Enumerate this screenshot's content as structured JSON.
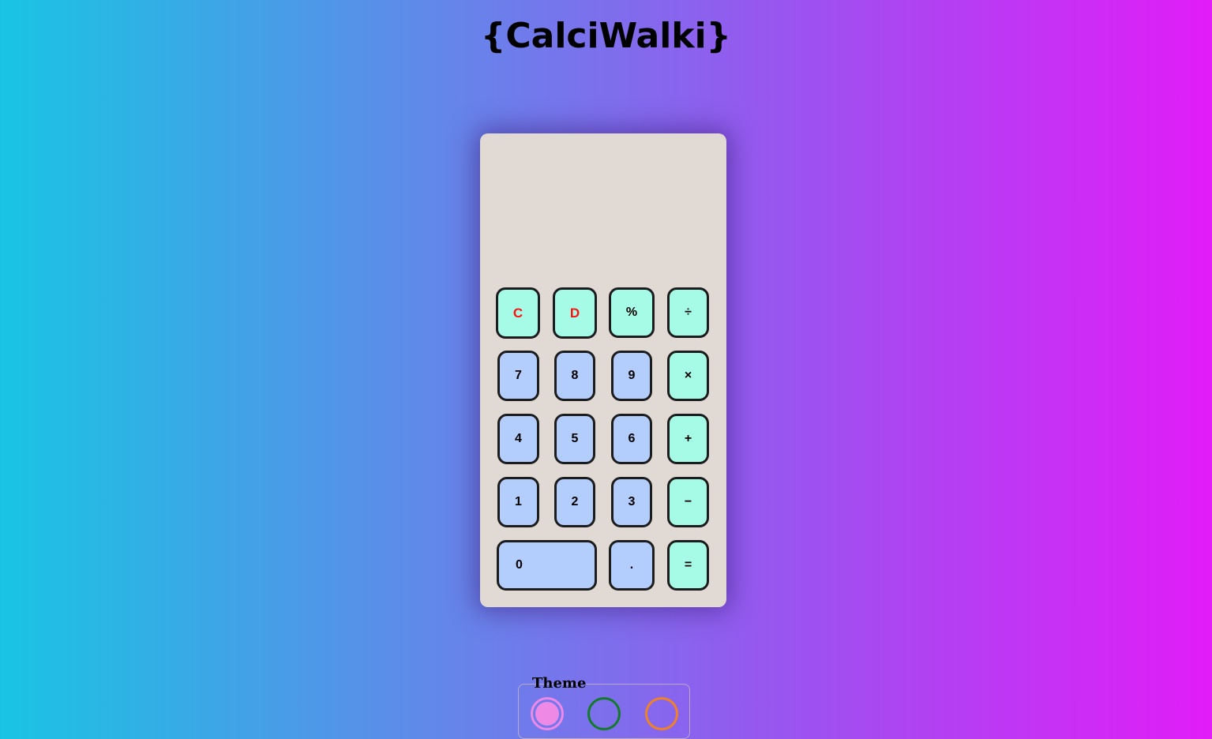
{
  "app": {
    "title": "{CalciWalki}"
  },
  "calculator": {
    "display_value": "",
    "keys": {
      "clear": "C",
      "delete": "D",
      "percent": "%",
      "divide": "÷",
      "seven": "7",
      "eight": "8",
      "nine": "9",
      "multiply": "×",
      "four": "4",
      "five": "5",
      "six": "6",
      "plus": "+",
      "one": "1",
      "two": "2",
      "three": "3",
      "minus": "−",
      "zero": "0",
      "decimal": ".",
      "equals": "="
    }
  },
  "theme": {
    "legend": "Theme",
    "selected": "pink",
    "options": [
      {
        "name": "pink",
        "color": "#ee8ae6"
      },
      {
        "name": "green",
        "color": "#137a2a"
      },
      {
        "name": "orange",
        "color": "#f08124"
      }
    ]
  },
  "colors": {
    "number_key": "#b3cdfd",
    "operator_key": "#a6fbe6",
    "danger_text": "#ff1010",
    "calculator_body": "#e0d9d4"
  }
}
